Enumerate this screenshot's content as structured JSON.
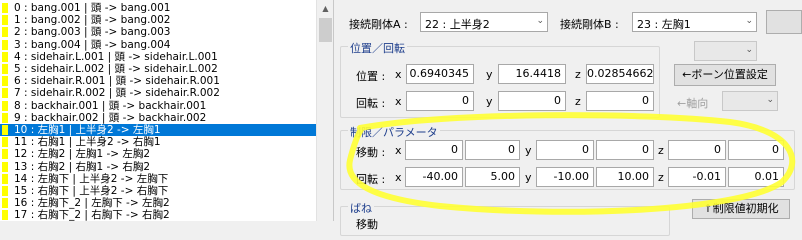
{
  "bone_list": {
    "items": [
      {
        "text": "0 : bang.001 | 頭 -> bang.001",
        "selected": false
      },
      {
        "text": "1 : bang.002 | 頭 -> bang.002",
        "selected": false
      },
      {
        "text": "2 : bang.003 | 頭 -> bang.003",
        "selected": false
      },
      {
        "text": "3 : bang.004 | 頭 -> bang.004",
        "selected": false
      },
      {
        "text": "4 : sidehair.L.001 | 頭 -> sidehair.L.001",
        "selected": false
      },
      {
        "text": "5 : sidehair.L.002 | 頭 -> sidehair.L.002",
        "selected": false
      },
      {
        "text": "6 : sidehair.R.001 | 頭 -> sidehair.R.001",
        "selected": false
      },
      {
        "text": "7 : sidehair.R.002 | 頭 -> sidehair.R.002",
        "selected": false
      },
      {
        "text": "8 : backhair.001 | 頭 -> backhair.001",
        "selected": false
      },
      {
        "text": "9 : backhair.002 | 頭 -> backhair.002",
        "selected": false
      },
      {
        "text": "10 : 左胸1 | 上半身2 -> 左胸1",
        "selected": true
      },
      {
        "text": "11 : 右胸1 | 上半身2 -> 右胸1",
        "selected": false
      },
      {
        "text": "12 : 左胸2 | 左胸1 -> 左胸2",
        "selected": false
      },
      {
        "text": "13 : 右胸2 | 右胸1 -> 右胸2",
        "selected": false
      },
      {
        "text": "14 : 左胸下 | 上半身2 -> 左胸下",
        "selected": false
      },
      {
        "text": "15 : 右胸下 | 上半身2 -> 右胸下",
        "selected": false
      },
      {
        "text": "16 : 左胸下_2 | 左胸下 -> 左胸2",
        "selected": false
      },
      {
        "text": "17 : 右胸下_2 | 右胸下 -> 右胸2",
        "selected": false
      }
    ]
  },
  "joint": {
    "body_a_label": "接続剛体A :",
    "body_a_value": "22 : 上半身2",
    "body_b_label": "接続剛体B :",
    "body_b_value": "23 : 左胸1",
    "position_rotation": {
      "title": "位置／回転",
      "position_label": "位置 :",
      "rotation_label": "回転 :",
      "position": {
        "x": "0.6940345",
        "y": "16.4418",
        "z": "0.02854662"
      },
      "rotation": {
        "x": "0",
        "y": "0",
        "z": "0"
      },
      "axis_x": "x",
      "axis_y": "y",
      "axis_z": "z"
    },
    "bone_position_button": "←ボーン位置設定",
    "axis_button": "←軸向",
    "limits": {
      "title": "制限／パラメータ",
      "move_label": "移動 :",
      "rotate_label": "回転 :",
      "move": {
        "x_min": "0",
        "x_max": "0",
        "y_min": "0",
        "y_max": "0",
        "z_min": "0",
        "z_max": "0"
      },
      "rotate": {
        "x_min": "-40.00",
        "x_max": "5.00",
        "y_min": "-10.00",
        "y_max": "10.00",
        "z_min": "-0.01",
        "z_max": "0.01"
      }
    },
    "spring": {
      "title": "ばね",
      "move_label": "移動"
    },
    "reset_limits_button": "↑制限値初期化"
  },
  "icons": {
    "combo_arrow": "chevron-down-icon",
    "scroll_up": "scroll-up-icon"
  },
  "colors": {
    "selection": "#0078d7",
    "marker": "#ffff00",
    "highlight": "#ffff33"
  }
}
